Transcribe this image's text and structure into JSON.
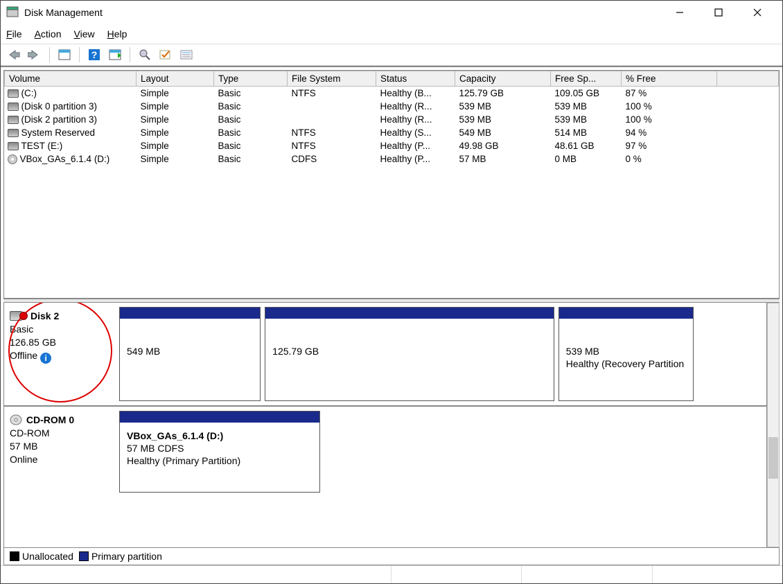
{
  "window": {
    "title": "Disk Management"
  },
  "menu": {
    "file": "File",
    "action": "Action",
    "view": "View",
    "help": "Help"
  },
  "columns": {
    "volume": "Volume",
    "layout": "Layout",
    "type": "Type",
    "filesystem": "File System",
    "status": "Status",
    "capacity": "Capacity",
    "freespace": "Free Sp...",
    "pctfree": "% Free"
  },
  "volumes": [
    {
      "name": "(C:)",
      "layout": "Simple",
      "type": "Basic",
      "fs": "NTFS",
      "status": "Healthy (B...",
      "cap": "125.79 GB",
      "free": "109.05 GB",
      "pct": "87 %",
      "kind": "hdd"
    },
    {
      "name": "(Disk 0 partition 3)",
      "layout": "Simple",
      "type": "Basic",
      "fs": "",
      "status": "Healthy (R...",
      "cap": "539 MB",
      "free": "539 MB",
      "pct": "100 %",
      "kind": "hdd"
    },
    {
      "name": "(Disk 2 partition 3)",
      "layout": "Simple",
      "type": "Basic",
      "fs": "",
      "status": "Healthy (R...",
      "cap": "539 MB",
      "free": "539 MB",
      "pct": "100 %",
      "kind": "hdd"
    },
    {
      "name": "System Reserved",
      "layout": "Simple",
      "type": "Basic",
      "fs": "NTFS",
      "status": "Healthy (S...",
      "cap": "549 MB",
      "free": "514 MB",
      "pct": "94 %",
      "kind": "hdd"
    },
    {
      "name": "TEST (E:)",
      "layout": "Simple",
      "type": "Basic",
      "fs": "NTFS",
      "status": "Healthy (P...",
      "cap": "49.98 GB",
      "free": "48.61 GB",
      "pct": "97 %",
      "kind": "hdd"
    },
    {
      "name": "VBox_GAs_6.1.4 (D:)",
      "layout": "Simple",
      "type": "Basic",
      "fs": "CDFS",
      "status": "Healthy (P...",
      "cap": "57 MB",
      "free": "0 MB",
      "pct": "0 %",
      "kind": "cd"
    }
  ],
  "disk2": {
    "name": "Disk 2",
    "type": "Basic",
    "size": "126.85 GB",
    "state": "Offline",
    "parts": [
      {
        "label": "549 MB",
        "sub": "",
        "width": "22%"
      },
      {
        "label": "125.79 GB",
        "sub": "",
        "width": "45%"
      },
      {
        "label": "539 MB",
        "sub": "Healthy (Recovery Partition",
        "width": "21%"
      }
    ]
  },
  "cdrom": {
    "name": "CD-ROM 0",
    "type": "CD-ROM",
    "size": "57 MB",
    "state": "Online",
    "vol": {
      "name": "VBox_GAs_6.1.4  (D:)",
      "line2": "57 MB CDFS",
      "line3": "Healthy (Primary Partition)"
    }
  },
  "legend": {
    "unalloc": "Unallocated",
    "primary": "Primary partition"
  }
}
